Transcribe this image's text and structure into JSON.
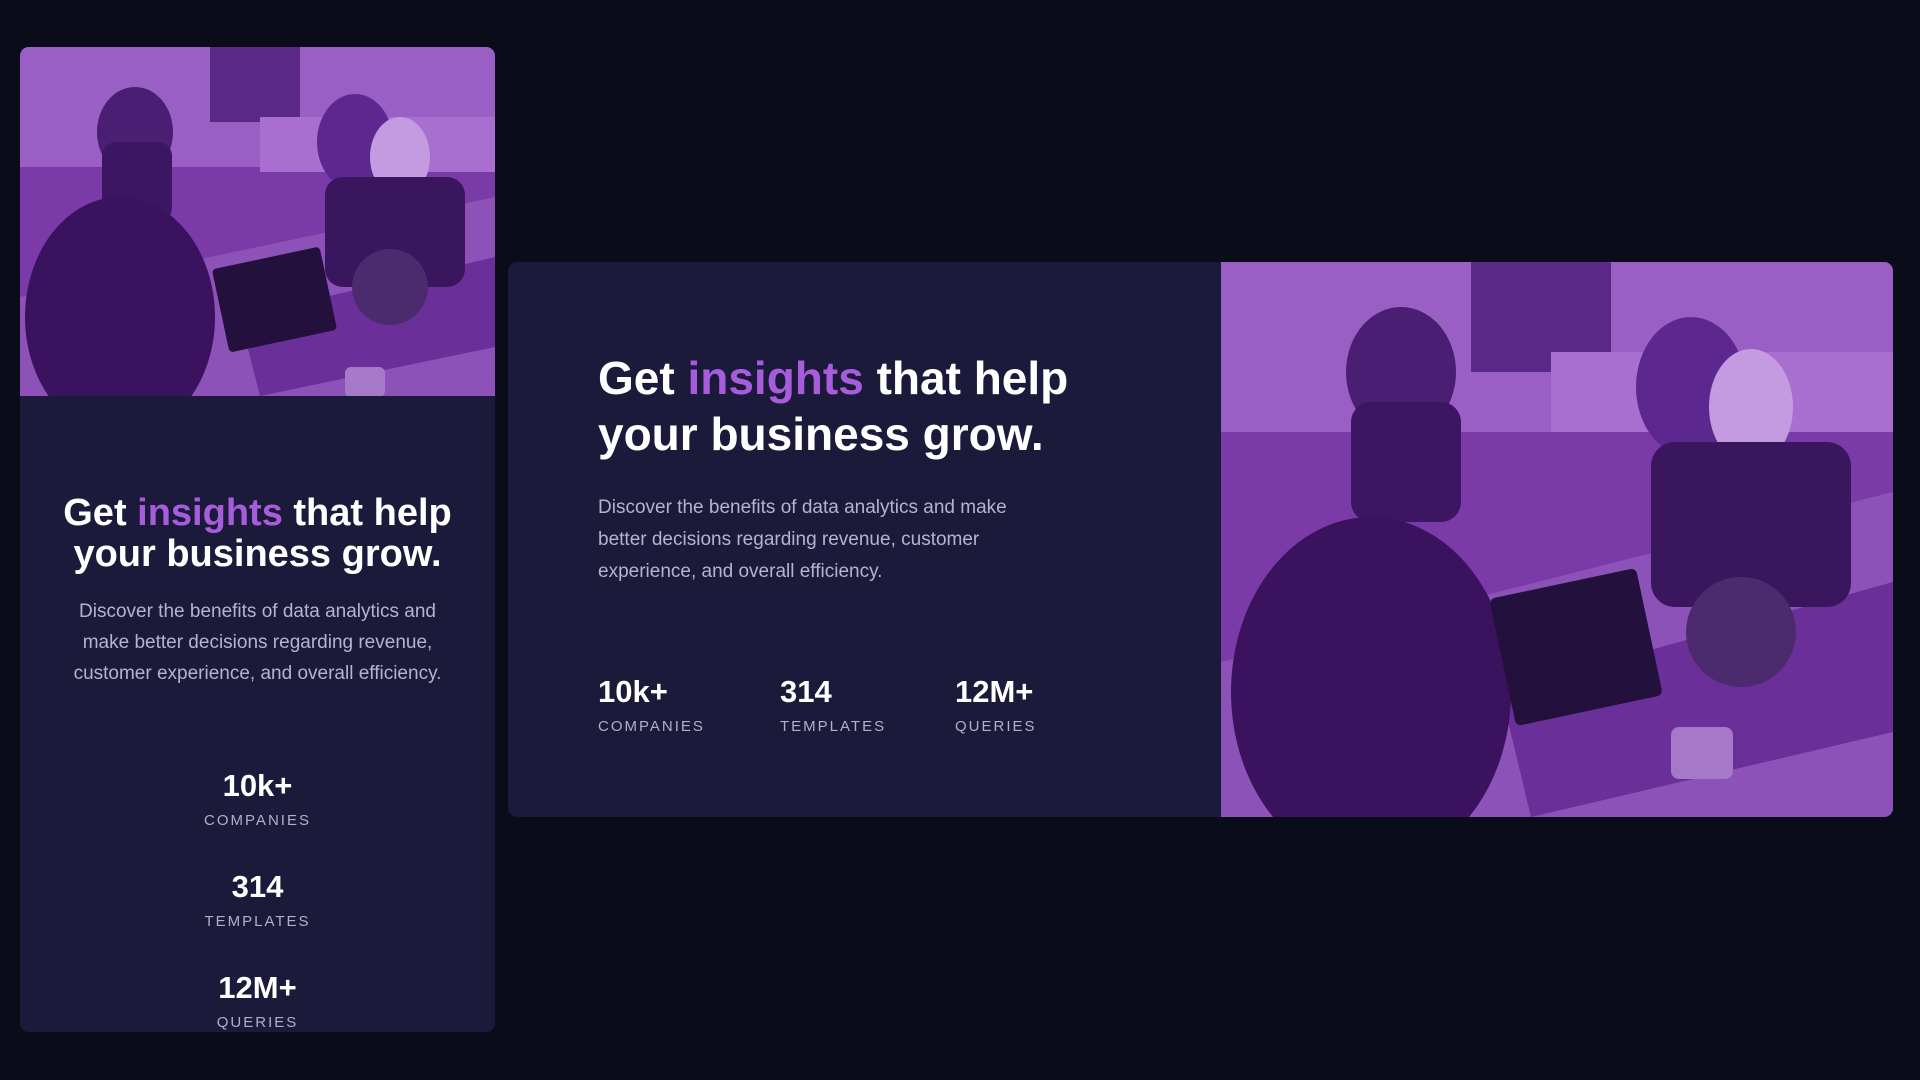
{
  "colors": {
    "accent": "#a75ddb",
    "card": "#1c1a3b",
    "background": "#0a0c1a",
    "overlay": "#8a45c2"
  },
  "mobile": {
    "heading": {
      "before": "Get ",
      "accent": "insights",
      "after": " that help your business grow."
    },
    "description": "Discover the benefits of data analytics and make better decisions regarding revenue, customer experience, and overall efficiency.",
    "stats": [
      {
        "value": "10k+",
        "label": "COMPANIES"
      },
      {
        "value": "314",
        "label": "TEMPLATES"
      },
      {
        "value": "12M+",
        "label": "QUERIES"
      }
    ]
  },
  "desktop": {
    "heading": {
      "before": "Get ",
      "accent": "insights",
      "after": " that help your business grow."
    },
    "description": "Discover the benefits of data analytics and make better decisions regarding revenue, customer experience, and overall efficiency.",
    "stats": [
      {
        "value": "10k+",
        "label": "COMPANIES"
      },
      {
        "value": "314",
        "label": "TEMPLATES"
      },
      {
        "value": "12M+",
        "label": "QUERIES"
      }
    ]
  },
  "photo": {
    "icon": "office-team-photo"
  }
}
